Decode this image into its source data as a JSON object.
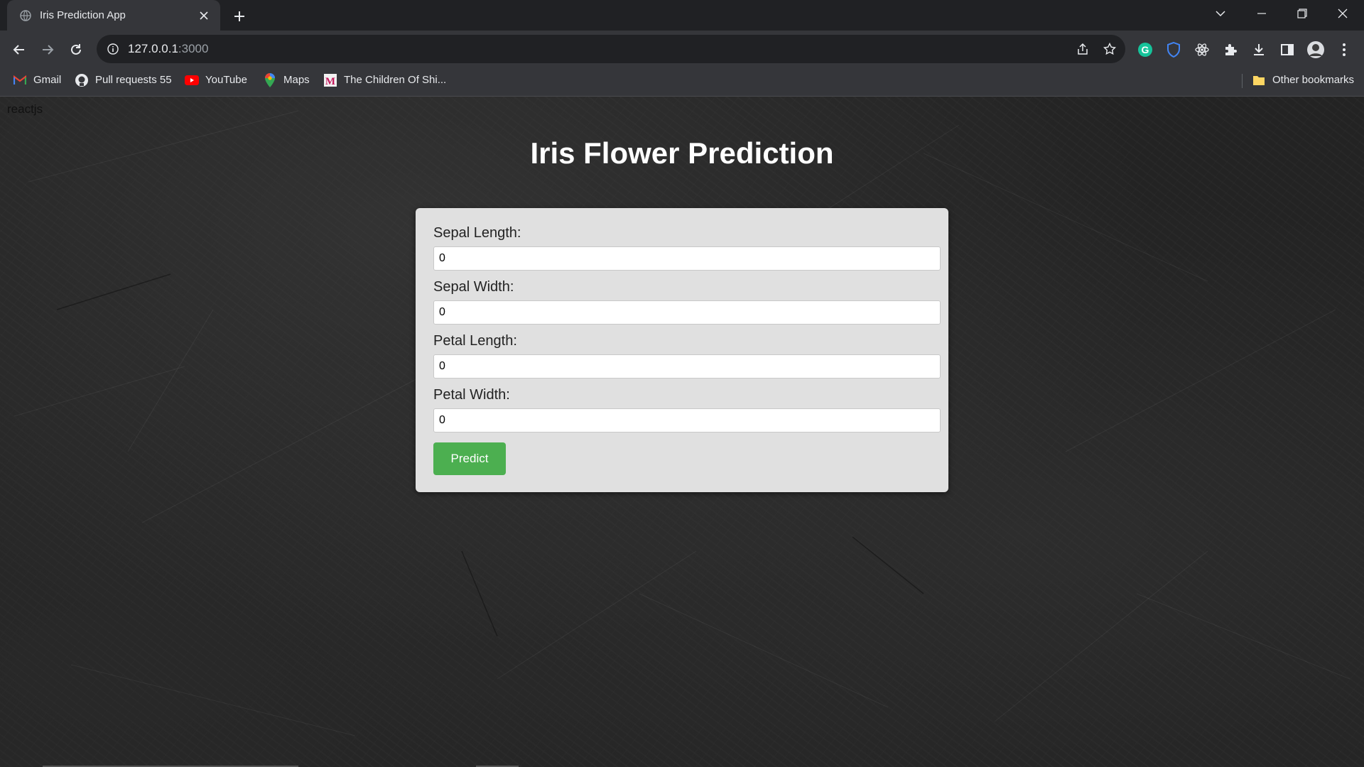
{
  "browser": {
    "tab": {
      "title": "Iris Prediction App",
      "close_glyph": "✕",
      "favicon": "globe-icon"
    },
    "new_tab_icon": "plus-icon",
    "window_controls": [
      "tab-search-icon",
      "minimize-icon",
      "restore-icon",
      "close-icon"
    ],
    "toolbar": {
      "back_icon": "back-arrow-icon",
      "forward_icon": "forward-arrow-icon",
      "reload_icon": "reload-icon",
      "url_host": "127.0.0.1",
      "url_port": ":3000",
      "omnibox_icons": [
        "share-icon",
        "star-icon"
      ],
      "extensions": [
        "grammarly-icon",
        "shield-extension-icon",
        "react-devtools-icon",
        "puzzle-extensions-icon",
        "download-icon",
        "side-panel-icon",
        "profile-avatar",
        "menu-dots-icon"
      ]
    },
    "bookmarks": [
      {
        "label": "Gmail",
        "icon": "gmail-icon"
      },
      {
        "label": "Pull requests 55",
        "icon": "github-icon"
      },
      {
        "label": "YouTube",
        "icon": "youtube-icon"
      },
      {
        "label": "Maps",
        "icon": "maps-pin-icon"
      },
      {
        "label": "The Children Of Shi...",
        "icon": "medium-icon"
      }
    ],
    "other_bookmarks": {
      "label": "Other bookmarks",
      "icon": "folder-icon"
    }
  },
  "page": {
    "corner_text": "reactjs",
    "title": "Iris Flower Prediction",
    "form": {
      "fields": [
        {
          "label": "Sepal Length:",
          "value": "0"
        },
        {
          "label": "Sepal Width:",
          "value": "0"
        },
        {
          "label": "Petal Length:",
          "value": "0"
        },
        {
          "label": "Petal Width:",
          "value": "0"
        }
      ],
      "submit_label": "Predict"
    }
  },
  "colors": {
    "button": "#4caf50",
    "card": "#e0e0e0",
    "title": "#ffffff"
  }
}
